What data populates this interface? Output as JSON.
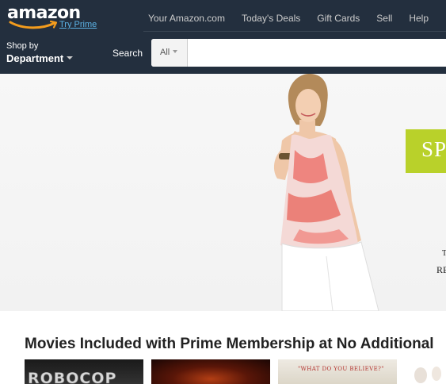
{
  "header": {
    "logo_text": "amazon",
    "try_prime": "Try Prime",
    "nav_links": [
      "Your Amazon.com",
      "Today's Deals",
      "Gift Cards",
      "Sell",
      "Help"
    ],
    "shop_by": {
      "small": "Shop by",
      "big": "Department"
    },
    "search": {
      "label": "Search",
      "department": "All",
      "value": ""
    }
  },
  "hero": {
    "promo_text": "SP",
    "side_text_1": "T",
    "side_text_2": "RE"
  },
  "movies": {
    "section_title": "Movies Included with Prime Membership at No Additional",
    "items": [
      {
        "title_text": "ROBOCOP"
      },
      {
        "title_text": ""
      },
      {
        "title_text": "\"WHAT DO YOU BELIEVE?\""
      },
      {
        "title_text": ""
      }
    ]
  },
  "colors": {
    "header_bg": "#232f3e",
    "logo_smile": "#f39c1d",
    "prime_link": "#5cb3e6",
    "promo_green": "#b9d12a"
  },
  "icons": [
    "amazon-smile-logo",
    "chevron-down-icon"
  ]
}
